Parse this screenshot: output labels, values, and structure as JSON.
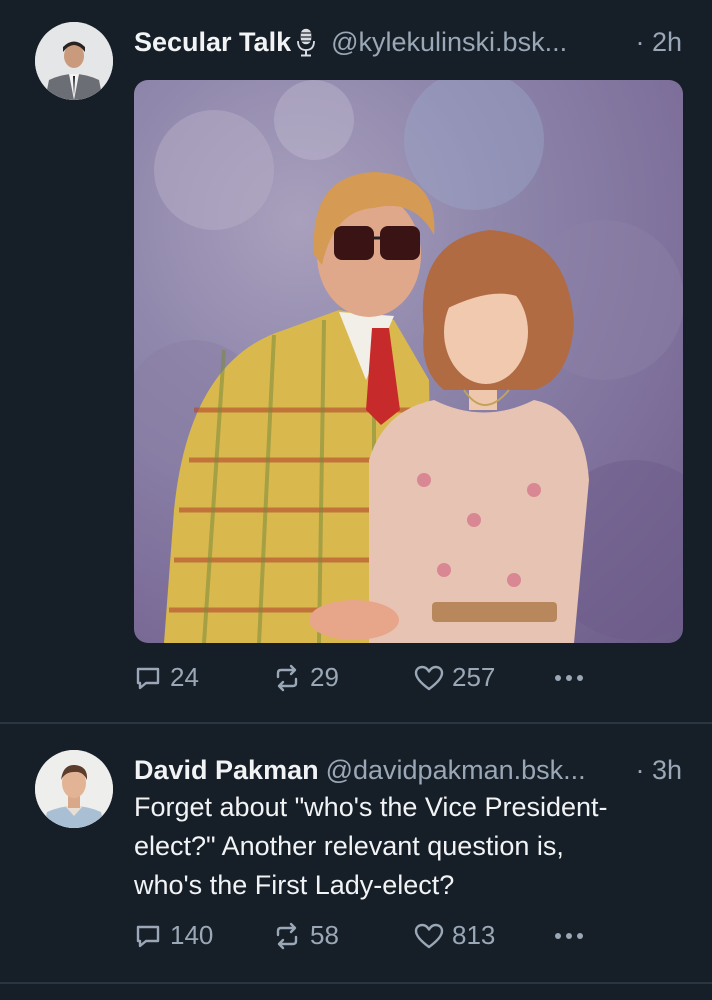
{
  "posts": [
    {
      "author": "Secular Talk",
      "handle": "@kylekulinski.bsk...",
      "time": "· 2h",
      "text_lines": [],
      "counts": {
        "replies": "24",
        "reposts": "29",
        "likes": "257"
      }
    },
    {
      "author": "David Pakman",
      "handle": "@davidpakman.bsk...",
      "time": "· 3h",
      "text_lines": [
        "Forget about \"who's the Vice President-",
        "elect?\" Another relevant question is,",
        "who's the First Lady-elect?"
      ],
      "counts": {
        "replies": "140",
        "reposts": "58",
        "likes": "813"
      }
    }
  ],
  "icons": {
    "reply": "speech-bubble-icon",
    "repost": "repost-arrows-icon",
    "like": "heart-outline-icon",
    "more": "ellipsis-icon",
    "badge": "microphone-emoji"
  },
  "colors": {
    "background": "#161e27",
    "text": "#f1f3f5",
    "muted": "#9aa7b6",
    "divider": "#2a3542"
  }
}
